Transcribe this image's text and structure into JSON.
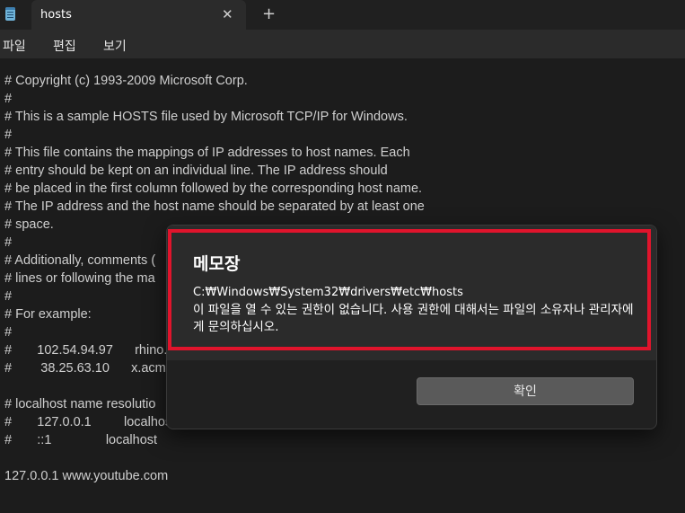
{
  "tab": {
    "title": "hosts",
    "close_glyph": "✕",
    "new_tab_glyph": "+"
  },
  "menu": [
    "파일",
    "편집",
    "보기"
  ],
  "editor_lines": [
    "# Copyright (c) 1993-2009 Microsoft Corp.",
    "#",
    "# This is a sample HOSTS file used by Microsoft TCP/IP for Windows.",
    "#",
    "# This file contains the mappings of IP addresses to host names. Each",
    "# entry should be kept on an individual line. The IP address should",
    "# be placed in the first column followed by the corresponding host name.",
    "# The IP address and the host name should be separated by at least one",
    "# space.",
    "#",
    "# Additionally, comments (",
    "# lines or following the ma",
    "#",
    "# For example:",
    "#",
    "#       102.54.94.97      rhino.",
    "#        38.25.63.10      x.acme",
    "",
    "# localhost name resolutio",
    "#       127.0.0.1         localhos",
    "#       ::1               localhost",
    "",
    "127.0.0.1 www.youtube.com"
  ],
  "dialog": {
    "title": "메모장",
    "path": "C:₩Windows₩System32₩drivers₩etc₩hosts",
    "message": "이 파일을 열 수 있는 권한이 없습니다. 사용 권한에 대해서는 파일의 소유자나 관리자에게 문의하십시오.",
    "ok_label": "확인"
  },
  "colors": {
    "highlight": "#e0142c",
    "background": "#1c1c1c"
  }
}
